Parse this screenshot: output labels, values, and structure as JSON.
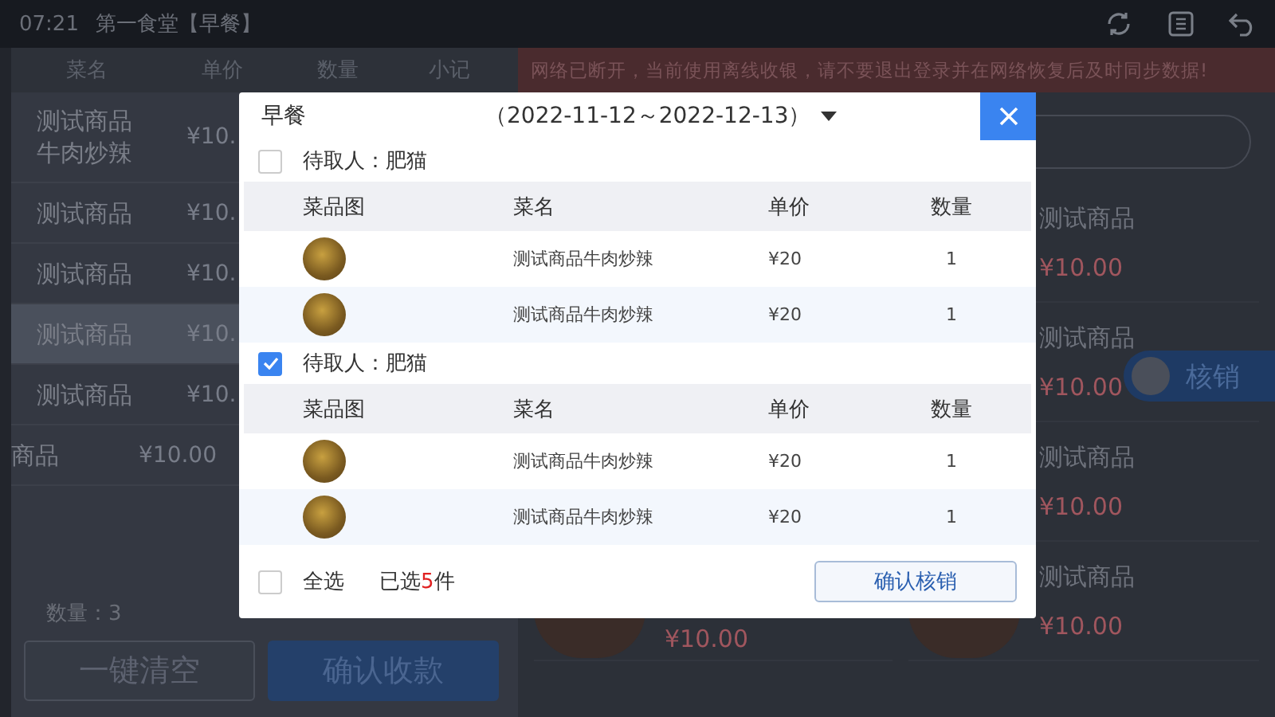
{
  "status_bar": {
    "time": "07:21",
    "title": "第一食堂【早餐】"
  },
  "cart": {
    "columns": [
      "菜名",
      "单价",
      "数量",
      "小记"
    ],
    "rows": [
      {
        "kind": "normal",
        "name": "测试商品牛肉炒辣",
        "price": "¥10.",
        "selected": false
      },
      {
        "kind": "normal",
        "name": "测试商品",
        "price": "¥10.",
        "selected": false
      },
      {
        "kind": "normal",
        "name": "测试商品",
        "price": "¥10.",
        "selected": false
      },
      {
        "kind": "normal",
        "name": "测试商品",
        "price": "¥10.",
        "selected": true
      },
      {
        "kind": "normal",
        "name": "测试商品",
        "price": "¥10.",
        "selected": false
      },
      {
        "kind": "swiped",
        "name": "商品",
        "price": "¥10.00",
        "selected": false
      }
    ],
    "quantity": "数量：3",
    "clear_button": "一键清空",
    "pay_button": "确认收款"
  },
  "banner": "网络已断开，当前使用离线收银，请不要退出登录并在网络恢复后及时同步数据!",
  "products": [
    {
      "name": "测试商品",
      "price": "¥10.00"
    },
    {
      "name": "测试商品",
      "price": "¥10.00"
    },
    {
      "name": "测试商品",
      "price": "¥10.00"
    },
    {
      "price": "¥10.00"
    },
    {
      "name": "测试商品",
      "price": "¥10.00"
    }
  ],
  "toggle": {
    "label": "核销",
    "on": false
  },
  "modal": {
    "title": "早餐",
    "date_range": "（2022-11-12～2022-12-13）",
    "groups": [
      {
        "label": "待取人：肥猫",
        "checked": false,
        "columns": [
          "菜品图",
          "菜名",
          "单价",
          "数量"
        ],
        "items": [
          {
            "name": "测试商品牛肉炒辣",
            "price": "¥20",
            "qty": "1"
          },
          {
            "name": "测试商品牛肉炒辣",
            "price": "¥20",
            "qty": "1"
          }
        ]
      },
      {
        "label": "待取人：肥猫",
        "checked": true,
        "columns": [
          "菜品图",
          "菜名",
          "单价",
          "数量"
        ],
        "items": [
          {
            "name": "测试商品牛肉炒辣",
            "price": "¥20",
            "qty": "1"
          },
          {
            "name": "测试商品牛肉炒辣",
            "price": "¥20",
            "qty": "1"
          }
        ]
      }
    ],
    "select_all": {
      "label": "全选",
      "checked": false
    },
    "selected_prefix": "已选",
    "selected_count": "5",
    "selected_suffix": "件",
    "confirm_button": "确认核销"
  }
}
